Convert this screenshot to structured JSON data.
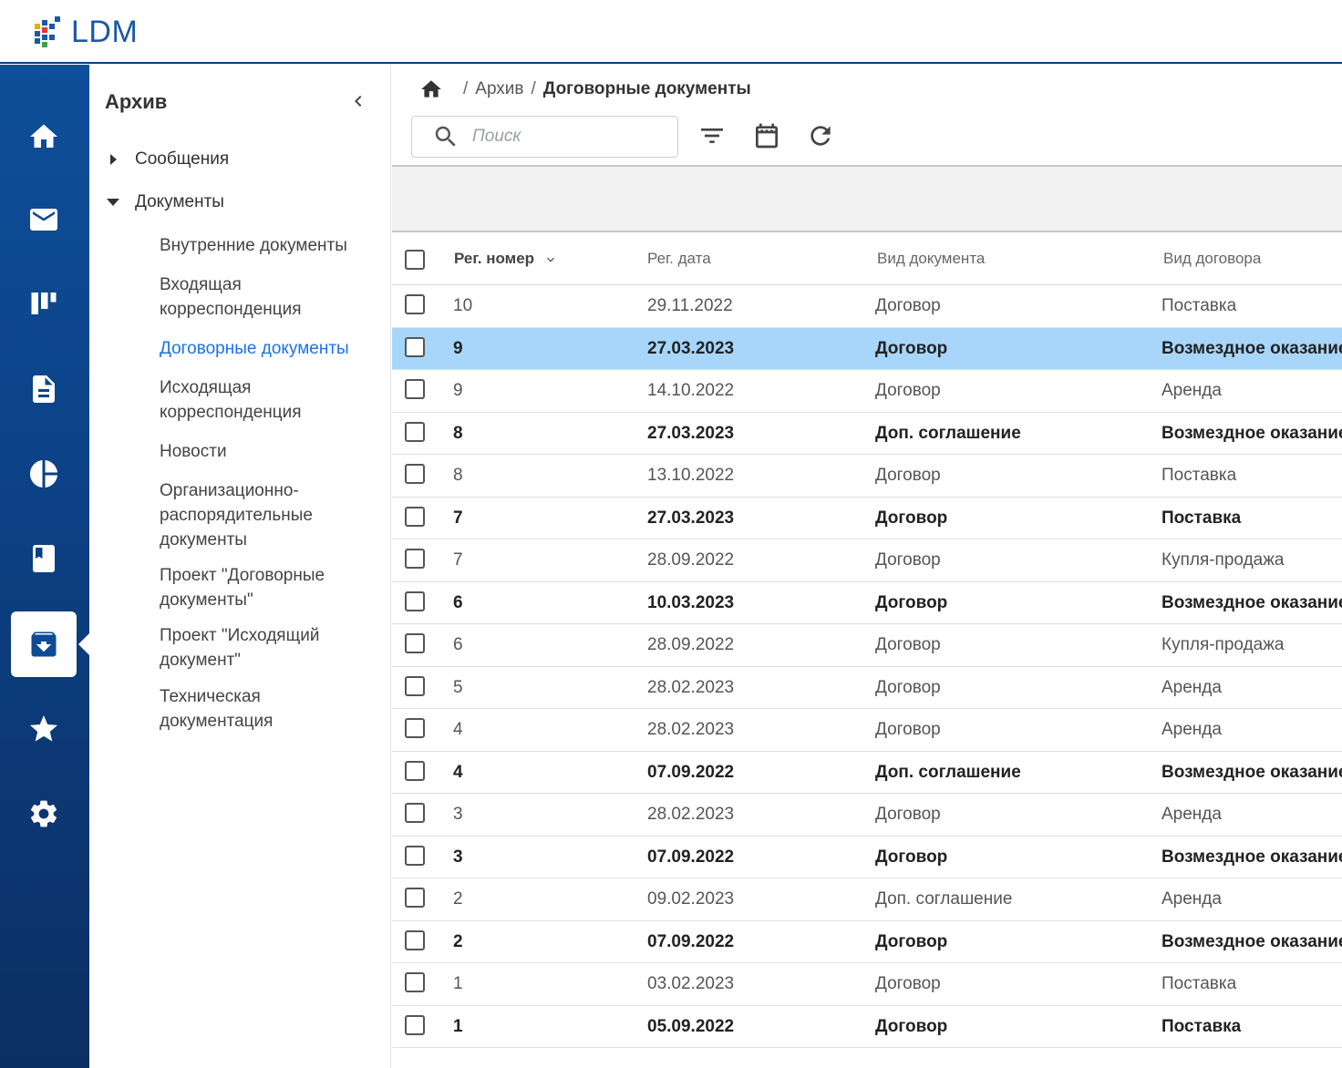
{
  "app": {
    "logo_text": "LDM"
  },
  "rail": {
    "items": [
      {
        "name": "home-icon",
        "active": false
      },
      {
        "name": "mail-icon",
        "active": false
      },
      {
        "name": "board-icon",
        "active": false
      },
      {
        "name": "document-icon",
        "active": false
      },
      {
        "name": "pie-chart-icon",
        "active": false
      },
      {
        "name": "book-icon",
        "active": false
      },
      {
        "name": "archive-icon",
        "active": true
      },
      {
        "name": "star-icon",
        "active": false
      },
      {
        "name": "gear-icon",
        "active": false
      }
    ]
  },
  "nav": {
    "title": "Архив",
    "nodes": [
      {
        "label": "Сообщения",
        "expanded": false
      },
      {
        "label": "Документы",
        "expanded": true
      }
    ],
    "leaves": [
      {
        "label": "Внутренние документы"
      },
      {
        "label": "Входящая корреспонденция"
      },
      {
        "label": "Договорные документы",
        "active": true
      },
      {
        "label": "Исходящая корреспонденция"
      },
      {
        "label": "Новости"
      },
      {
        "label": "Организационно-распорядительные документы"
      },
      {
        "label": "Проект \"Договорные документы\""
      },
      {
        "label": "Проект \"Исходящий документ\""
      },
      {
        "label": "Техническая документация"
      }
    ]
  },
  "breadcrumb": {
    "sep1": "/",
    "item1": "Архив",
    "sep2": "/",
    "current": "Договорные документы"
  },
  "search": {
    "placeholder": "Поиск"
  },
  "table": {
    "columns": [
      "Рег. номер",
      "Рег. дата",
      "Вид документа",
      "Вид договора"
    ],
    "rows": [
      {
        "num": "10",
        "date": "29.11.2022",
        "doc_type": "Договор",
        "contract_type": "Поставка",
        "bold": false,
        "selected": false
      },
      {
        "num": "9",
        "date": "27.03.2023",
        "doc_type": "Договор",
        "contract_type": "Возмездное оказание",
        "bold": true,
        "selected": true
      },
      {
        "num": "9",
        "date": "14.10.2022",
        "doc_type": "Договор",
        "contract_type": "Аренда",
        "bold": false,
        "selected": false
      },
      {
        "num": "8",
        "date": "27.03.2023",
        "doc_type": "Доп. соглашение",
        "contract_type": "Возмездное оказание",
        "bold": true,
        "selected": false
      },
      {
        "num": "8",
        "date": "13.10.2022",
        "doc_type": "Договор",
        "contract_type": "Поставка",
        "bold": false,
        "selected": false
      },
      {
        "num": "7",
        "date": "27.03.2023",
        "doc_type": "Договор",
        "contract_type": "Поставка",
        "bold": true,
        "selected": false
      },
      {
        "num": "7",
        "date": "28.09.2022",
        "doc_type": "Договор",
        "contract_type": "Купля-продажа",
        "bold": false,
        "selected": false
      },
      {
        "num": "6",
        "date": "10.03.2023",
        "doc_type": "Договор",
        "contract_type": "Возмездное оказание",
        "bold": true,
        "selected": false
      },
      {
        "num": "6",
        "date": "28.09.2022",
        "doc_type": "Договор",
        "contract_type": "Купля-продажа",
        "bold": false,
        "selected": false
      },
      {
        "num": "5",
        "date": "28.02.2023",
        "doc_type": "Договор",
        "contract_type": "Аренда",
        "bold": false,
        "selected": false
      },
      {
        "num": "4",
        "date": "28.02.2023",
        "doc_type": "Договор",
        "contract_type": "Аренда",
        "bold": false,
        "selected": false
      },
      {
        "num": "4",
        "date": "07.09.2022",
        "doc_type": "Доп. соглашение",
        "contract_type": "Возмездное оказание",
        "bold": true,
        "selected": false
      },
      {
        "num": "3",
        "date": "28.02.2023",
        "doc_type": "Договор",
        "contract_type": "Аренда",
        "bold": false,
        "selected": false
      },
      {
        "num": "3",
        "date": "07.09.2022",
        "doc_type": "Договор",
        "contract_type": "Возмездное оказание",
        "bold": true,
        "selected": false
      },
      {
        "num": "2",
        "date": "09.02.2023",
        "doc_type": "Доп. соглашение",
        "contract_type": "Аренда",
        "bold": false,
        "selected": false
      },
      {
        "num": "2",
        "date": "07.09.2022",
        "doc_type": "Договор",
        "contract_type": "Возмездное оказание",
        "bold": true,
        "selected": false
      },
      {
        "num": "1",
        "date": "03.02.2023",
        "doc_type": "Договор",
        "contract_type": "Поставка",
        "bold": false,
        "selected": false
      },
      {
        "num": "1",
        "date": "05.09.2022",
        "doc_type": "Договор",
        "contract_type": "Поставка",
        "bold": true,
        "selected": false
      }
    ]
  },
  "colors": {
    "rail": "#0c4287",
    "accent": "#1a73e8",
    "selected_row": "#a8d6fb"
  }
}
